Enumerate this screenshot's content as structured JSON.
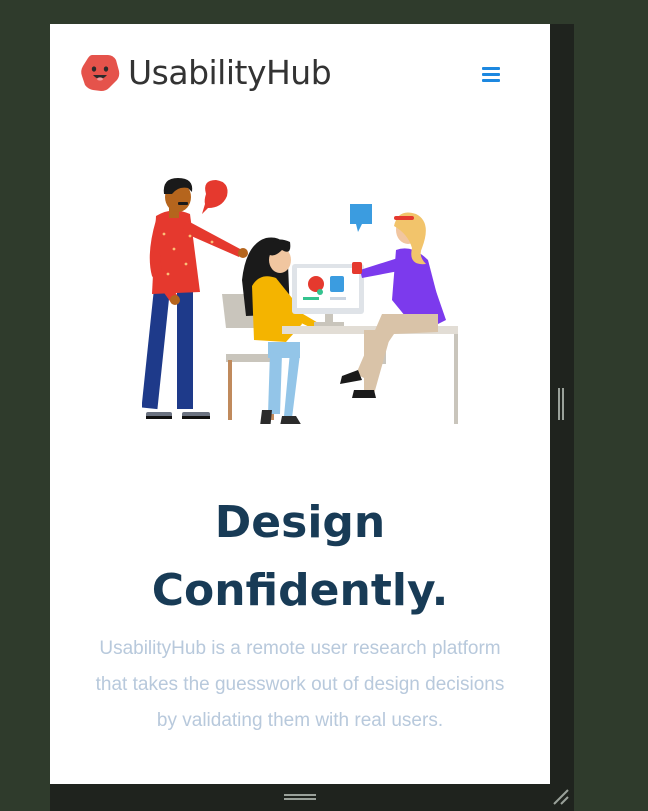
{
  "brand": {
    "name": "UsabilityHub",
    "logo_color": "#e5534b",
    "text_color": "#333333"
  },
  "header": {
    "menu_icon": "hamburger-menu-icon",
    "menu_color": "#1d88e0"
  },
  "hero": {
    "illustration": "team-at-computer-illustration",
    "headline_line1": "Design",
    "headline_line2": "Confidently.",
    "headline_color": "#183b56",
    "subtext": "UsabilityHub is a remote user research platform that takes the guesswork out of design decisions by validating them with real users.",
    "subtext_color": "#b8c9dc"
  },
  "window": {
    "background": "#2f3b2c",
    "frame_color": "#1f231e",
    "resize_handles": [
      "horizontal-resize-grip",
      "vertical-resize-grip",
      "corner-resize-grip"
    ]
  }
}
